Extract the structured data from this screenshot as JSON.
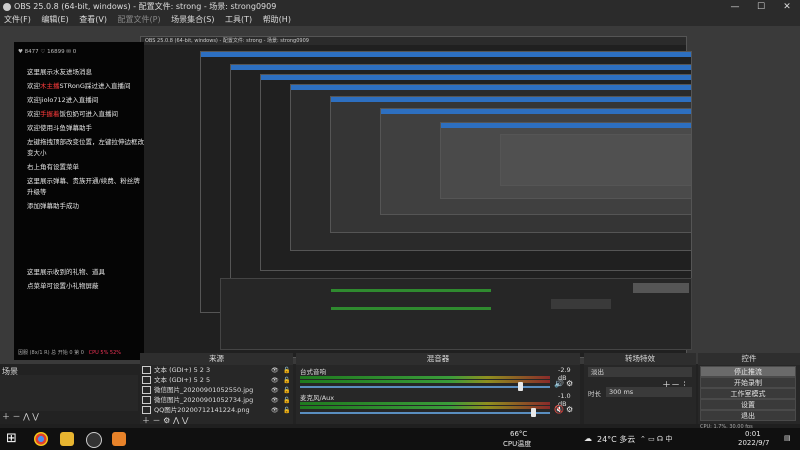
{
  "window": {
    "title": "OBS 25.0.8 (64-bit, windows) - 配置文件: strong - 场景: strong0909",
    "minimize_glyph": "—",
    "maximize_glyph": "☐",
    "close_glyph": "✕"
  },
  "menu": [
    "文件(F)",
    "编辑(E)",
    "查看(V)",
    "配置文件(P)",
    "场景集合(S)",
    "工具(T)",
    "帮助(H)"
  ],
  "preview": {
    "nested_title": "OBS 25.0.8 (64-bit, windows) - 配置文件: strong - 场景: strong0909",
    "chat": {
      "stats": "♥ 8477   ♡ 16899   ✉ 0",
      "lines": [
        {
          "text": "这里展示水友进场消息",
          "highlight": ""
        },
        {
          "text": "欢迎",
          "highlight": "木主播",
          "rest": "STRonG踩过进入直播间"
        },
        {
          "text": "欢迎jiolo712进入直播间",
          "highlight": ""
        },
        {
          "text": "欢迎",
          "highlight": "手握着",
          "rest": "饭包奶可进入直播间"
        },
        {
          "text": "欢迎使用斗鱼弹幕助手",
          "highlight": ""
        },
        {
          "text": "左键拖拽顶部改变位置，左键拉伸边框改",
          "highlight": ""
        },
        {
          "text": "变大小",
          "highlight": ""
        },
        {
          "text": "右上角有设置菜单",
          "highlight": ""
        },
        {
          "text": "这里展示弹幕、贵族开通/续费、粉丝牌",
          "highlight": ""
        },
        {
          "text": "升级等",
          "highlight": ""
        },
        {
          "text": "添加弹幕助手成功",
          "highlight": ""
        },
        {
          "text": "这里展示收到的礼物、道具",
          "highlight": ""
        },
        {
          "text": "点菜单可设置小礼物屏蔽",
          "highlight": ""
        }
      ],
      "footer_left": "因服 (8x/1 R) 总 开始 0 第 0",
      "footer_right": "CPU 5%  52%"
    }
  },
  "scenes": {
    "label": "场景"
  },
  "sources": {
    "header": "来源",
    "items": [
      {
        "name": "文本 (GDI+) 5 2 3",
        "icon": "text-icon"
      },
      {
        "name": "文本 (GDI+) 5 2 5",
        "icon": "text-icon"
      },
      {
        "name": "微信图片_20200901052550.jpg",
        "icon": "image-icon"
      },
      {
        "name": "微信图片_20200901052734.jpg",
        "icon": "image-icon"
      },
      {
        "name": "QQ图片20200712141224.png",
        "icon": "image-icon"
      }
    ]
  },
  "mixer": {
    "header": "混音器",
    "channels": [
      {
        "name": "台式音响",
        "db": "-2.9 dB",
        "muted": false,
        "level": 0.88
      },
      {
        "name": "麦克风/Aux",
        "db": "-1.0 dB",
        "muted": true,
        "level": 0.93
      }
    ]
  },
  "transitions": {
    "header": "转场特效",
    "type": "淡出",
    "duration_label": "时长",
    "duration_value": "300 ms"
  },
  "controls": {
    "header": "控件",
    "buttons": [
      "停止推流",
      "开始录制",
      "工作室模式",
      "设置",
      "退出"
    ]
  },
  "statusbar": {
    "text": "CPU: 1.7%, 30.00 fps"
  },
  "taskbar": {
    "temp": "66°C",
    "temp_label": "CPU温度",
    "weather": "24°C 多云",
    "time": "0:01",
    "date": "2022/9/7"
  }
}
